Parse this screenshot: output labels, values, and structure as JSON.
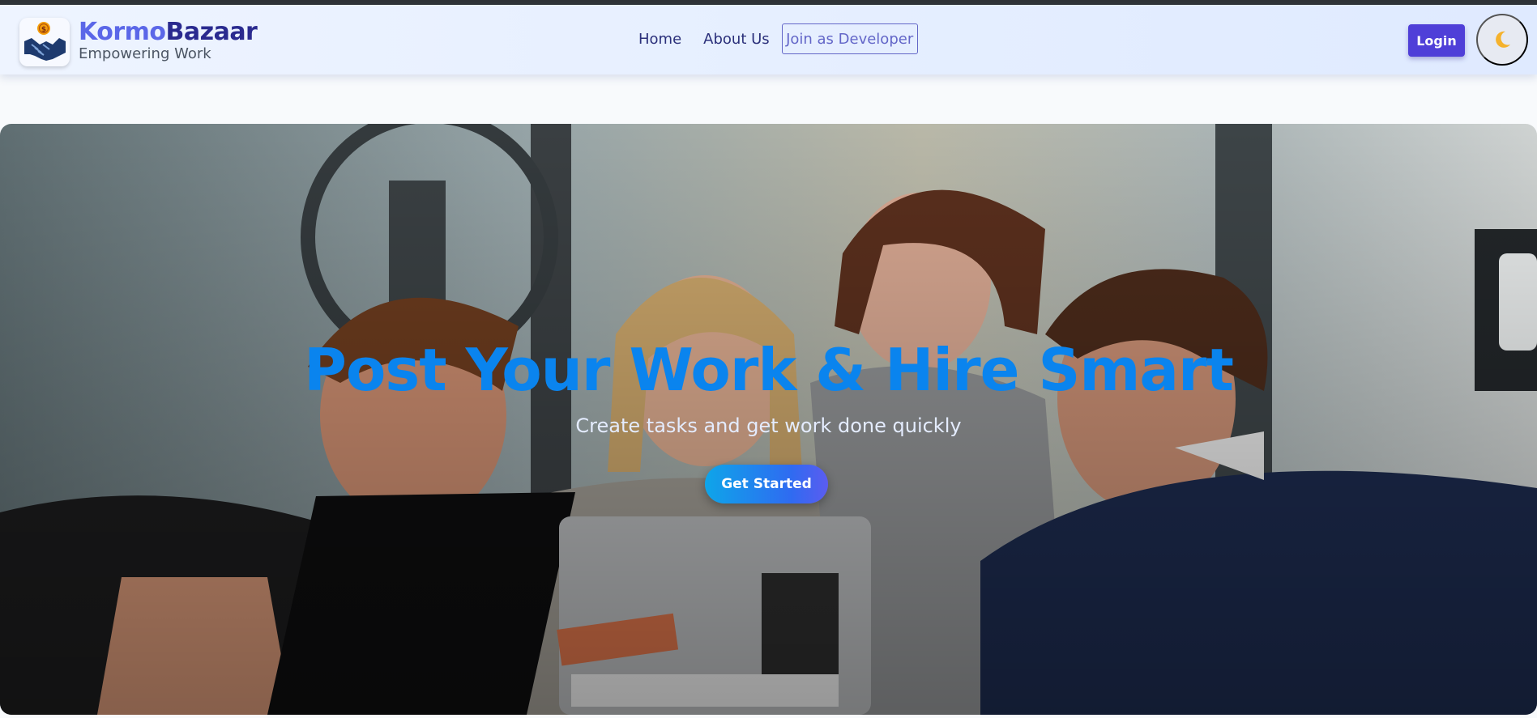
{
  "brand": {
    "name_part1": "Kormo",
    "name_part2": "Bazaar",
    "tagline": "Empowering Work",
    "logo_icon": "handshake-coin-icon"
  },
  "nav": {
    "home": "Home",
    "about": "About Us",
    "join": "Join as Developer",
    "login": "Login",
    "theme_icon": "moon-icon"
  },
  "hero": {
    "title": "Post Your Work & Hire Smart",
    "subtitle": "Create tasks and get work done quickly",
    "cta": "Get Started",
    "image": "team-of-four-looking-at-laptop-photo"
  },
  "colors": {
    "accent": "#4f3fd8",
    "hero_title": "#0a84ee",
    "brand_dark": "#2a2a8f",
    "brand_light": "#5b67e8"
  }
}
